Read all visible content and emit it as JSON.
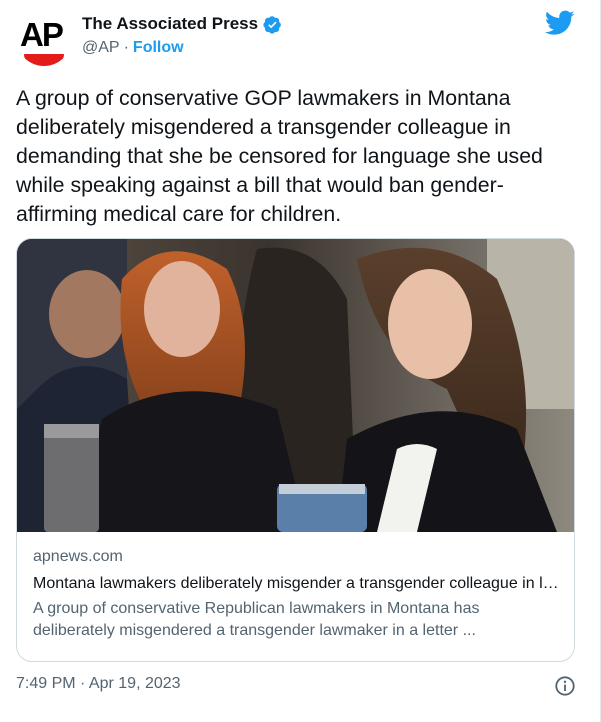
{
  "account": {
    "name": "The Associated Press",
    "handle": "@AP",
    "separator": "·",
    "follow_label": "Follow",
    "avatar_text": "AP",
    "verified_icon": "verified-badge-icon"
  },
  "tweet": {
    "text": "A group of conservative GOP lawmakers in Montana deliberately misgendered a transgender colleague in demanding that she be censored for language she used while speaking against a bill that would ban gender-affirming medical care for children."
  },
  "link_card": {
    "domain": "apnews.com",
    "headline": "Montana lawmakers deliberately misgender a transgender colleague in letter demanding censorship",
    "description": "A group of conservative Republican lawmakers in Montana has deliberately misgendered a transgender lawmaker in a letter ..."
  },
  "footer": {
    "timestamp": "7:49 PM · Apr 19, 2023"
  },
  "colors": {
    "accent": "#1d9bf0",
    "ap_red": "#e21b1b",
    "muted_text": "#536471"
  },
  "icons": [
    "twitter-bird-icon",
    "verified-badge-icon",
    "info-icon"
  ]
}
